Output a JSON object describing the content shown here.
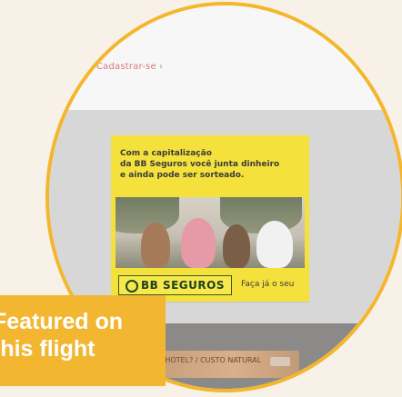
{
  "app": {
    "top_link": "Cadastrar-se ›"
  },
  "ad": {
    "headline_lines": [
      "Com a capitalização",
      "da BB Seguros você junta dinheiro",
      "e ainda pode ser sorteado."
    ],
    "brand": "BB SEGUROS",
    "cta": "Faça já o seu"
  },
  "footer": {
    "wood_label": "MAIS HOTEL? / CUSTO NATURAL"
  },
  "banner": {
    "line1": "Featured on",
    "line2": "this flight"
  },
  "colors": {
    "accent": "#f4b62c",
    "ad_yellow": "#f5e13c",
    "brand_green": "#1d3f20"
  },
  "icons": {
    "brand": "brand-logo-icon"
  }
}
